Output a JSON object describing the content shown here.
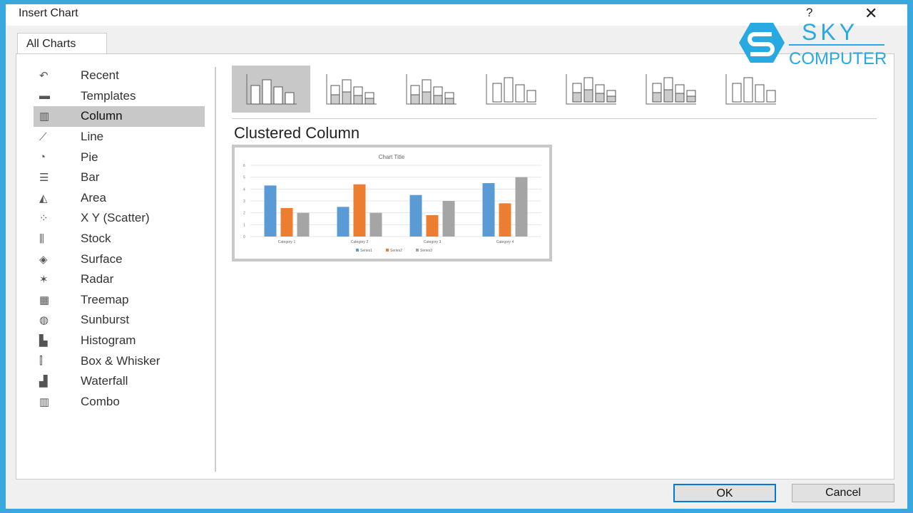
{
  "dialog": {
    "title": "Insert Chart",
    "help": "?",
    "close": "✕"
  },
  "tabs": [
    {
      "label": "All Charts"
    }
  ],
  "sidebar": {
    "items": [
      {
        "label": "Recent",
        "icon": "↶"
      },
      {
        "label": "Templates",
        "icon": "▬"
      },
      {
        "label": "Column",
        "icon": "▥",
        "selected": true
      },
      {
        "label": "Line",
        "icon": "⟋"
      },
      {
        "label": "Pie",
        "icon": "◔"
      },
      {
        "label": "Bar",
        "icon": "☰"
      },
      {
        "label": "Area",
        "icon": "◭"
      },
      {
        "label": "X Y (Scatter)",
        "icon": "⁘"
      },
      {
        "label": "Stock",
        "icon": "⫼"
      },
      {
        "label": "Surface",
        "icon": "◈"
      },
      {
        "label": "Radar",
        "icon": "✶"
      },
      {
        "label": "Treemap",
        "icon": "▦"
      },
      {
        "label": "Sunburst",
        "icon": "◍"
      },
      {
        "label": "Histogram",
        "icon": "▙"
      },
      {
        "label": "Box & Whisker",
        "icon": "⫿"
      },
      {
        "label": "Waterfall",
        "icon": "▟"
      },
      {
        "label": "Combo",
        "icon": "▥"
      }
    ]
  },
  "subtypes": [
    "clustered-column",
    "stacked-column",
    "100-stacked-column",
    "3d-clustered-column",
    "3d-stacked-column",
    "3d-100-stacked-column",
    "3d-column"
  ],
  "selected_subtype_label": "Clustered Column",
  "logo": {
    "text1": "SKY",
    "text2": "COMPUTER",
    "color": "#29a9e1"
  },
  "buttons": {
    "ok": "OK",
    "cancel": "Cancel"
  },
  "chart_data": {
    "type": "bar",
    "title": "Chart Title",
    "ylim": [
      0,
      6
    ],
    "yticks": [
      0,
      1,
      2,
      3,
      4,
      5,
      6
    ],
    "categories": [
      "Category 1",
      "Category 2",
      "Category 3",
      "Category 4"
    ],
    "series": [
      {
        "name": "Series1",
        "values": [
          4.3,
          2.5,
          3.5,
          4.5
        ],
        "color": "#5b9bd5"
      },
      {
        "name": "Series2",
        "values": [
          2.4,
          4.4,
          1.8,
          2.8
        ],
        "color": "#ed7d31"
      },
      {
        "name": "Series3",
        "values": [
          2,
          2,
          3,
          5
        ],
        "color": "#a5a5a5"
      }
    ],
    "legend": "bottom",
    "grid": true
  }
}
